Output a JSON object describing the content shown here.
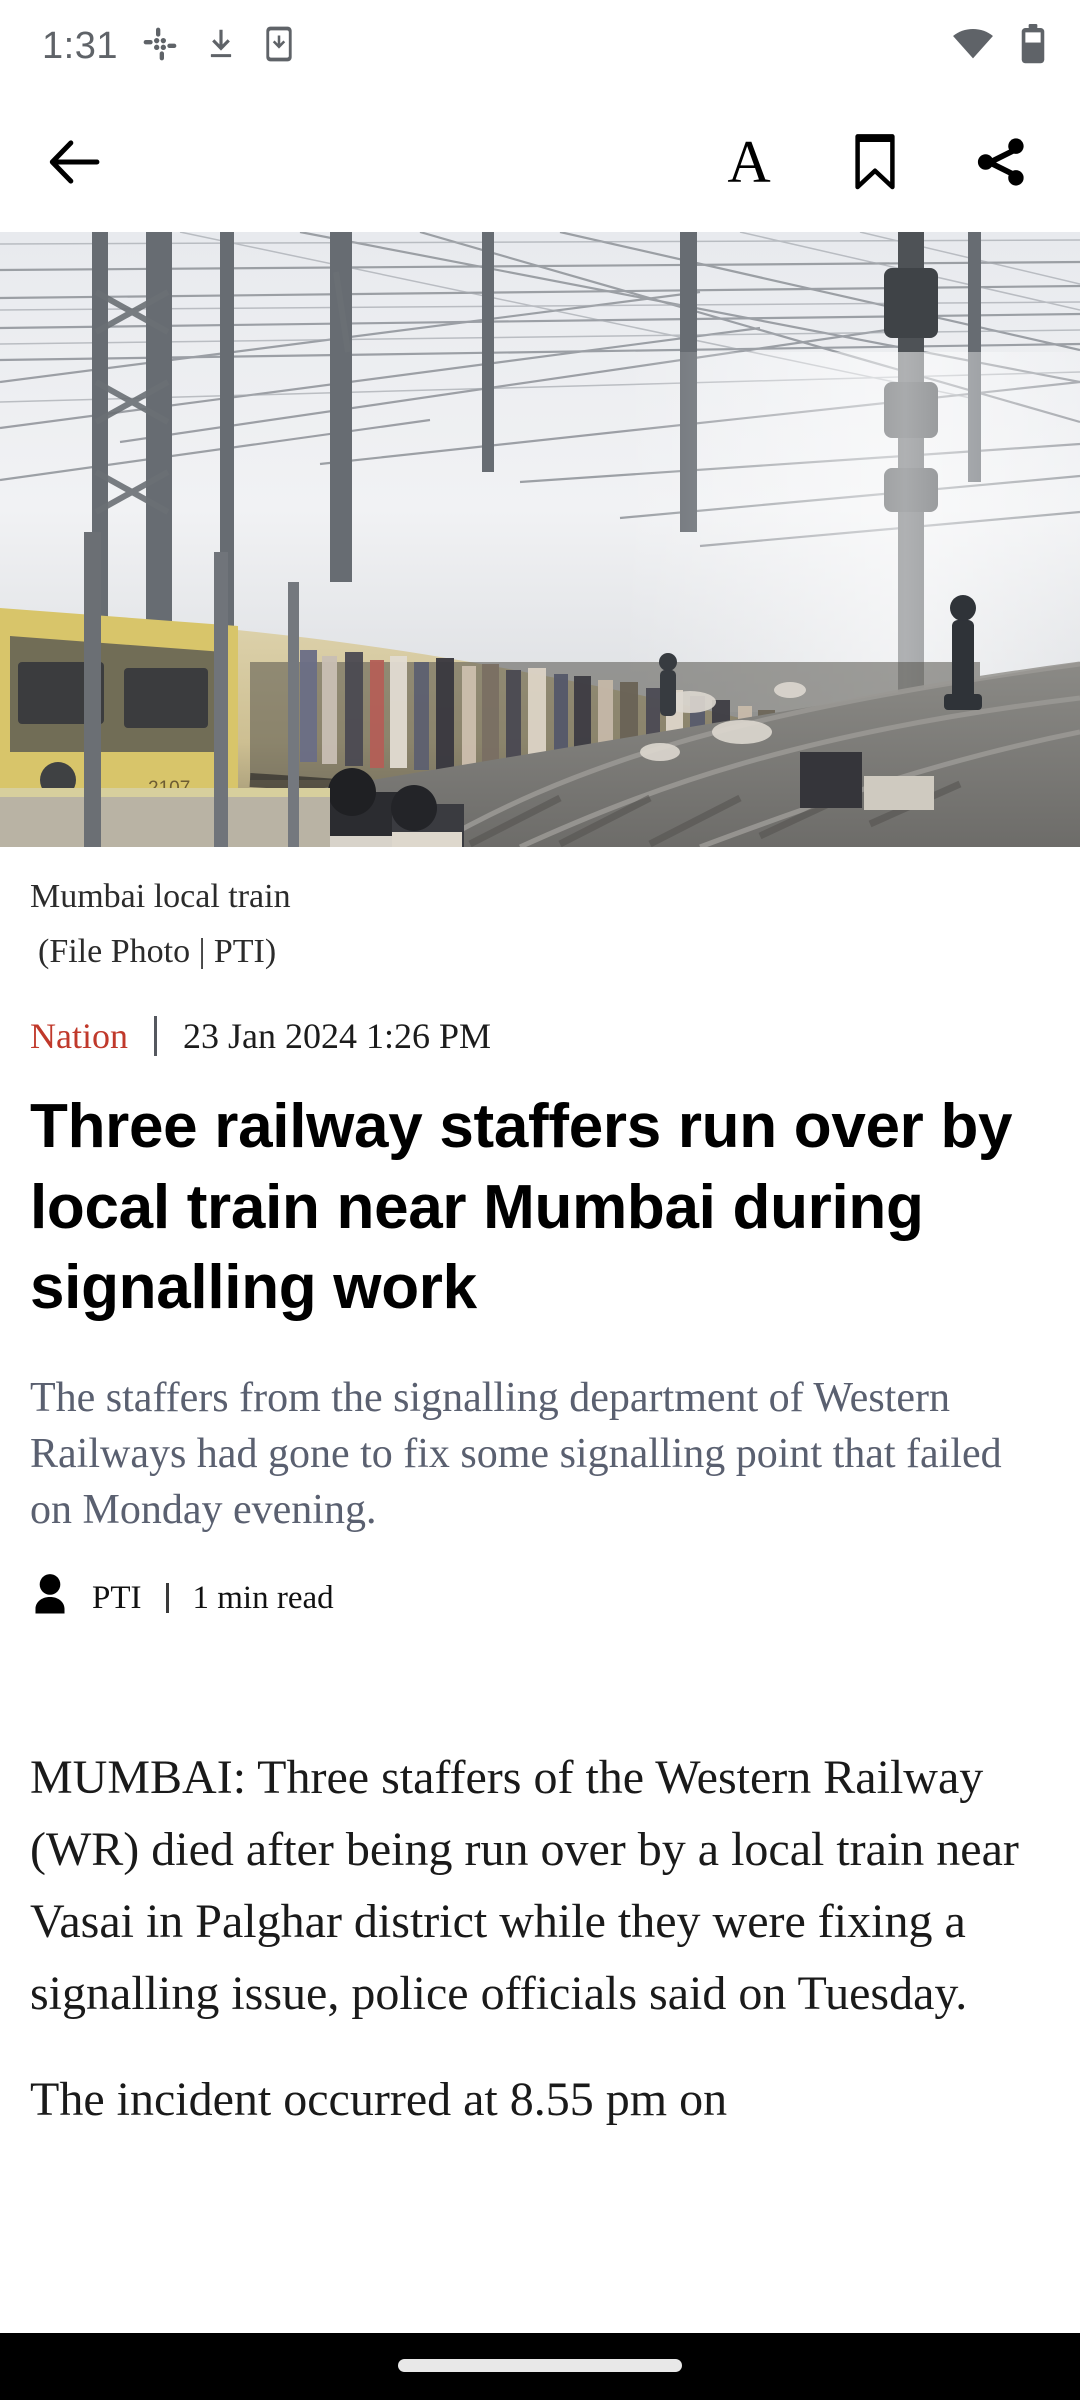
{
  "status_bar": {
    "time": "1:31",
    "left_icons": [
      "slack-icon",
      "download-icon",
      "phone-download-icon"
    ],
    "right_icons": [
      "wifi-icon",
      "battery-icon"
    ],
    "battery_level": "70"
  },
  "toolbar": {
    "back_label": "back-arrow",
    "font_size_label": "A",
    "bookmark_label": "bookmark-icon",
    "share_label": "share-icon"
  },
  "hero": {
    "alt": "Crowded Mumbai local train on railway tracks with overhead electric wires",
    "train_number": "2107"
  },
  "caption": {
    "line1": "Mumbai local train",
    "line2": "(File Photo | PTI)"
  },
  "meta": {
    "category": "Nation",
    "date": "23 Jan 2024  1:26 PM",
    "category_color": "#c0392b"
  },
  "headline": "Three railway staffers run over by local train near Mumbai during signalling work",
  "standfirst": "The staffers from the signalling department of Western Railways had gone to fix some signalling point that failed on Monday evening.",
  "byline": {
    "author": "PTI",
    "read_time": "1 min read"
  },
  "body": {
    "paragraphs": [
      "MUMBAI: Three staffers of the Western Railway (WR) died after being run over by a local train near Vasai in Palghar district while they were fixing a signalling issue, police officials said on Tuesday.",
      "The incident occurred at 8.55 pm on"
    ]
  },
  "nav_bar": {
    "gesture_pill": "home-gesture-pill"
  }
}
